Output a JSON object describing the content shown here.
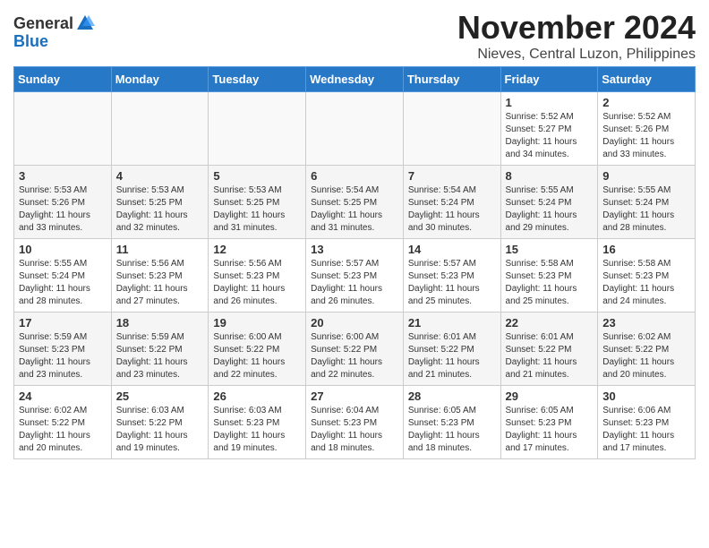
{
  "header": {
    "logo_general": "General",
    "logo_blue": "Blue",
    "month": "November 2024",
    "location": "Nieves, Central Luzon, Philippines"
  },
  "weekdays": [
    "Sunday",
    "Monday",
    "Tuesday",
    "Wednesday",
    "Thursday",
    "Friday",
    "Saturday"
  ],
  "weeks": [
    [
      {
        "day": "",
        "info": ""
      },
      {
        "day": "",
        "info": ""
      },
      {
        "day": "",
        "info": ""
      },
      {
        "day": "",
        "info": ""
      },
      {
        "day": "",
        "info": ""
      },
      {
        "day": "1",
        "info": "Sunrise: 5:52 AM\nSunset: 5:27 PM\nDaylight: 11 hours and 34 minutes."
      },
      {
        "day": "2",
        "info": "Sunrise: 5:52 AM\nSunset: 5:26 PM\nDaylight: 11 hours and 33 minutes."
      }
    ],
    [
      {
        "day": "3",
        "info": "Sunrise: 5:53 AM\nSunset: 5:26 PM\nDaylight: 11 hours and 33 minutes."
      },
      {
        "day": "4",
        "info": "Sunrise: 5:53 AM\nSunset: 5:25 PM\nDaylight: 11 hours and 32 minutes."
      },
      {
        "day": "5",
        "info": "Sunrise: 5:53 AM\nSunset: 5:25 PM\nDaylight: 11 hours and 31 minutes."
      },
      {
        "day": "6",
        "info": "Sunrise: 5:54 AM\nSunset: 5:25 PM\nDaylight: 11 hours and 31 minutes."
      },
      {
        "day": "7",
        "info": "Sunrise: 5:54 AM\nSunset: 5:24 PM\nDaylight: 11 hours and 30 minutes."
      },
      {
        "day": "8",
        "info": "Sunrise: 5:55 AM\nSunset: 5:24 PM\nDaylight: 11 hours and 29 minutes."
      },
      {
        "day": "9",
        "info": "Sunrise: 5:55 AM\nSunset: 5:24 PM\nDaylight: 11 hours and 28 minutes."
      }
    ],
    [
      {
        "day": "10",
        "info": "Sunrise: 5:55 AM\nSunset: 5:24 PM\nDaylight: 11 hours and 28 minutes."
      },
      {
        "day": "11",
        "info": "Sunrise: 5:56 AM\nSunset: 5:23 PM\nDaylight: 11 hours and 27 minutes."
      },
      {
        "day": "12",
        "info": "Sunrise: 5:56 AM\nSunset: 5:23 PM\nDaylight: 11 hours and 26 minutes."
      },
      {
        "day": "13",
        "info": "Sunrise: 5:57 AM\nSunset: 5:23 PM\nDaylight: 11 hours and 26 minutes."
      },
      {
        "day": "14",
        "info": "Sunrise: 5:57 AM\nSunset: 5:23 PM\nDaylight: 11 hours and 25 minutes."
      },
      {
        "day": "15",
        "info": "Sunrise: 5:58 AM\nSunset: 5:23 PM\nDaylight: 11 hours and 25 minutes."
      },
      {
        "day": "16",
        "info": "Sunrise: 5:58 AM\nSunset: 5:23 PM\nDaylight: 11 hours and 24 minutes."
      }
    ],
    [
      {
        "day": "17",
        "info": "Sunrise: 5:59 AM\nSunset: 5:23 PM\nDaylight: 11 hours and 23 minutes."
      },
      {
        "day": "18",
        "info": "Sunrise: 5:59 AM\nSunset: 5:22 PM\nDaylight: 11 hours and 23 minutes."
      },
      {
        "day": "19",
        "info": "Sunrise: 6:00 AM\nSunset: 5:22 PM\nDaylight: 11 hours and 22 minutes."
      },
      {
        "day": "20",
        "info": "Sunrise: 6:00 AM\nSunset: 5:22 PM\nDaylight: 11 hours and 22 minutes."
      },
      {
        "day": "21",
        "info": "Sunrise: 6:01 AM\nSunset: 5:22 PM\nDaylight: 11 hours and 21 minutes."
      },
      {
        "day": "22",
        "info": "Sunrise: 6:01 AM\nSunset: 5:22 PM\nDaylight: 11 hours and 21 minutes."
      },
      {
        "day": "23",
        "info": "Sunrise: 6:02 AM\nSunset: 5:22 PM\nDaylight: 11 hours and 20 minutes."
      }
    ],
    [
      {
        "day": "24",
        "info": "Sunrise: 6:02 AM\nSunset: 5:22 PM\nDaylight: 11 hours and 20 minutes."
      },
      {
        "day": "25",
        "info": "Sunrise: 6:03 AM\nSunset: 5:22 PM\nDaylight: 11 hours and 19 minutes."
      },
      {
        "day": "26",
        "info": "Sunrise: 6:03 AM\nSunset: 5:23 PM\nDaylight: 11 hours and 19 minutes."
      },
      {
        "day": "27",
        "info": "Sunrise: 6:04 AM\nSunset: 5:23 PM\nDaylight: 11 hours and 18 minutes."
      },
      {
        "day": "28",
        "info": "Sunrise: 6:05 AM\nSunset: 5:23 PM\nDaylight: 11 hours and 18 minutes."
      },
      {
        "day": "29",
        "info": "Sunrise: 6:05 AM\nSunset: 5:23 PM\nDaylight: 11 hours and 17 minutes."
      },
      {
        "day": "30",
        "info": "Sunrise: 6:06 AM\nSunset: 5:23 PM\nDaylight: 11 hours and 17 minutes."
      }
    ]
  ]
}
